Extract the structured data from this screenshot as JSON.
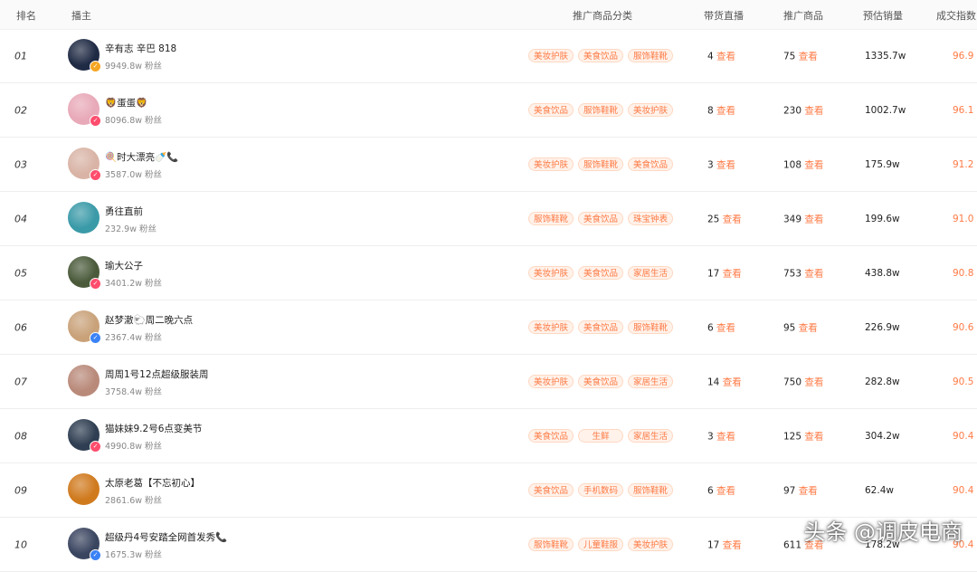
{
  "header": {
    "rank": "排名",
    "anchor": "播主",
    "category": "推广商品分类",
    "live": "带货直播",
    "goods": "推广商品",
    "sales": "预估销量",
    "score": "成交指数"
  },
  "view_label": "查看",
  "rows": [
    {
      "rank": "01",
      "name": "辛有志 辛巴 818",
      "fans": "9949.8w 粉丝",
      "tags": [
        "美妆护肤",
        "美食饮品",
        "服饰鞋靴"
      ],
      "live": "4",
      "goods": "75",
      "sales": "1335.7w",
      "score": "96.9",
      "avatar_color": "#1f2a44",
      "badge_color": "#f5a623"
    },
    {
      "rank": "02",
      "name": "🦁蛋蛋🦁",
      "fans": "8096.8w 粉丝",
      "tags": [
        "美食饮品",
        "服饰鞋靴",
        "美妆护肤"
      ],
      "live": "8",
      "goods": "230",
      "sales": "1002.7w",
      "score": "96.1",
      "avatar_color": "#e8a9b8",
      "badge_color": "#ff4d6d"
    },
    {
      "rank": "03",
      "name": "🍭时大漂亮🍼📞",
      "fans": "3587.0w 粉丝",
      "tags": [
        "美妆护肤",
        "服饰鞋靴",
        "美食饮品"
      ],
      "live": "3",
      "goods": "108",
      "sales": "175.9w",
      "score": "91.2",
      "avatar_color": "#d9b4a6",
      "badge_color": "#ff4d6d"
    },
    {
      "rank": "04",
      "name": "勇往直前",
      "fans": "232.9w 粉丝",
      "tags": [
        "服饰鞋靴",
        "美食饮品",
        "珠宝钟表"
      ],
      "live": "25",
      "goods": "349",
      "sales": "199.6w",
      "score": "91.0",
      "avatar_color": "#3a9aa8",
      "badge_color": ""
    },
    {
      "rank": "05",
      "name": "瑜大公子",
      "fans": "3401.2w 粉丝",
      "tags": [
        "美妆护肤",
        "美食饮品",
        "家居生活"
      ],
      "live": "17",
      "goods": "753",
      "sales": "438.8w",
      "score": "90.8",
      "avatar_color": "#4a5a3a",
      "badge_color": "#ff4d6d"
    },
    {
      "rank": "06",
      "name": "赵梦澈🐑周二晚六点",
      "fans": "2367.4w 粉丝",
      "tags": [
        "美妆护肤",
        "美食饮品",
        "服饰鞋靴"
      ],
      "live": "6",
      "goods": "95",
      "sales": "226.9w",
      "score": "90.6",
      "avatar_color": "#c9a27a",
      "badge_color": "#3b82f6"
    },
    {
      "rank": "07",
      "name": "周周1号12点超级服装周",
      "fans": "3758.4w 粉丝",
      "tags": [
        "美妆护肤",
        "美食饮品",
        "家居生活"
      ],
      "live": "14",
      "goods": "750",
      "sales": "282.8w",
      "score": "90.5",
      "avatar_color": "#b98a7a",
      "badge_color": ""
    },
    {
      "rank": "08",
      "name": "猫妹妹9.2号6点变美节",
      "fans": "4990.8w 粉丝",
      "tags": [
        "美食饮品",
        "生鲜",
        "家居生活"
      ],
      "live": "3",
      "goods": "125",
      "sales": "304.2w",
      "score": "90.4",
      "avatar_color": "#2f3e52",
      "badge_color": "#ff4d6d"
    },
    {
      "rank": "09",
      "name": "太原老葛【不忘初心】",
      "fans": "2861.6w 粉丝",
      "tags": [
        "美食饮品",
        "手机数码",
        "服饰鞋靴"
      ],
      "live": "6",
      "goods": "97",
      "sales": "62.4w",
      "score": "90.4",
      "avatar_color": "#d07a1e",
      "badge_color": ""
    },
    {
      "rank": "10",
      "name": "超级丹4号安踏全网首发秀📞",
      "fans": "1675.3w 粉丝",
      "tags": [
        "服饰鞋靴",
        "儿童鞋服",
        "美妆护肤"
      ],
      "live": "17",
      "goods": "611",
      "sales": "178.2w",
      "score": "90.4",
      "avatar_color": "#3a4560",
      "badge_color": "#3b82f6"
    }
  ],
  "watermark": "头条 @调皮电商"
}
